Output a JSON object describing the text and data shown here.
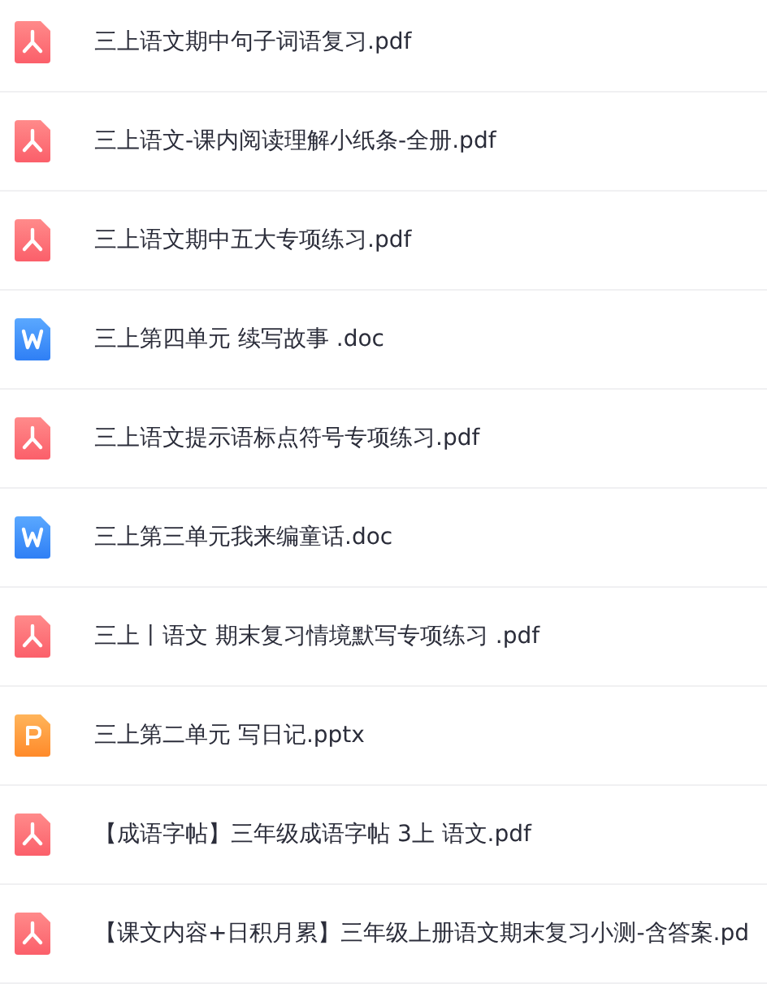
{
  "files": [
    {
      "kind": "pdf",
      "name": "三上语文期中句子词语复习.pdf"
    },
    {
      "kind": "pdf",
      "name": "三上语文-课内阅读理解小纸条-全册.pdf"
    },
    {
      "kind": "pdf",
      "name": "三上语文期中五大专项练习.pdf"
    },
    {
      "kind": "word",
      "name": "三上第四单元 续写故事 .doc"
    },
    {
      "kind": "pdf",
      "name": "三上语文提示语标点符号专项练习.pdf"
    },
    {
      "kind": "word",
      "name": "三上第三单元我来编童话.doc"
    },
    {
      "kind": "pdf",
      "name": "三上丨语文 期末复习情境默写专项练习 .pdf"
    },
    {
      "kind": "ppt",
      "name": "三上第二单元 写日记.pptx"
    },
    {
      "kind": "pdf",
      "name": "【成语字帖】三年级成语字帖 3上 语文.pdf"
    },
    {
      "kind": "pdf",
      "name": "【课文内容+日积月累】三年级上册语文期末复习小测-含答案.pd"
    }
  ]
}
